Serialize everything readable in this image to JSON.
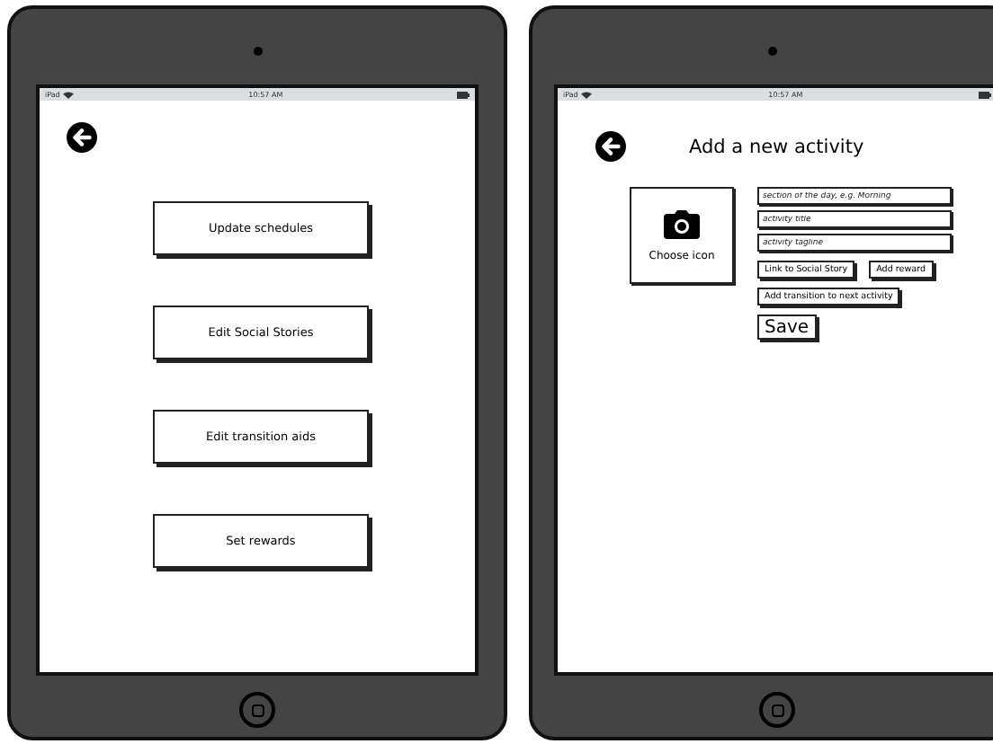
{
  "devices": [
    {
      "kind": "menu",
      "status_bar": {
        "carrier": "iPad",
        "time": "10:57 AM"
      },
      "buttons": [
        "Update schedules",
        "Edit Social Stories",
        "Edit transition aids",
        "Set rewards"
      ]
    },
    {
      "kind": "form",
      "status_bar": {
        "carrier": "iPad",
        "time": "10:57 AM"
      },
      "title": "Add a new activity",
      "icon_picker": {
        "label": "Choose icon"
      },
      "fields": [
        {
          "placeholder": "section of the day, e.g. Morning"
        },
        {
          "placeholder": "activity title"
        },
        {
          "placeholder": "activity tagline"
        }
      ],
      "actions": [
        "Link to Social Story",
        "Add reward"
      ],
      "transition_button": "Add transition to next activity",
      "save_button": "Save"
    }
  ]
}
